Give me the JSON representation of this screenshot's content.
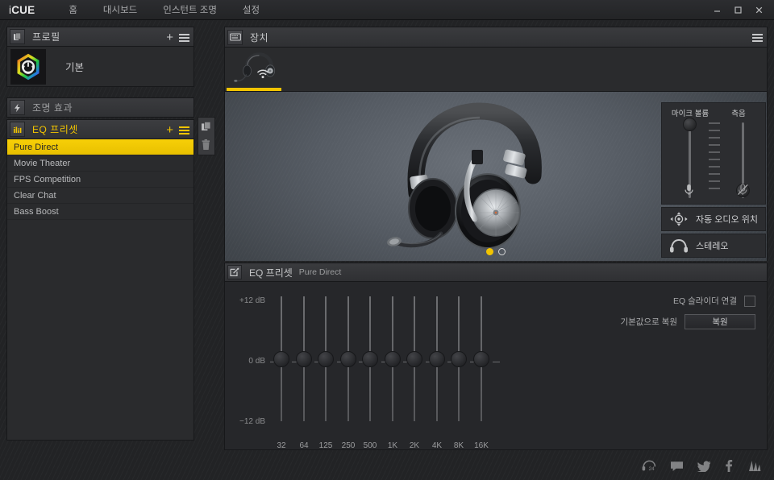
{
  "app": {
    "brand_i": "i",
    "brand_cue": "CUE",
    "nav": [
      {
        "label": "홈",
        "name": "nav-home"
      },
      {
        "label": "대시보드",
        "name": "nav-dashboard"
      },
      {
        "label": "인스턴트 조명",
        "name": "nav-instant-lighting"
      },
      {
        "label": "설정",
        "name": "nav-settings"
      }
    ],
    "window": {
      "minimize": "—",
      "maximize": "□",
      "close": "✕"
    }
  },
  "sidebar": {
    "profile": {
      "header_title": "프로필",
      "header_icon": "profile-stack-icon",
      "add_label": "+",
      "menu_icon": "hamburger-icon",
      "item_name": "기본"
    },
    "lighting": {
      "header_title": "조명 효과",
      "header_icon": "lightning-bolt-icon"
    },
    "eq": {
      "header_title": "EQ 프리셋",
      "header_icon": "equalizer-icon",
      "add_label": "+",
      "menu_icon": "hamburger-icon",
      "presets": [
        {
          "label": "Pure Direct",
          "selected": true
        },
        {
          "label": "Movie Theater",
          "selected": false
        },
        {
          "label": "FPS Competition",
          "selected": false
        },
        {
          "label": "Clear Chat",
          "selected": false
        },
        {
          "label": "Bass Boost",
          "selected": false
        }
      ]
    },
    "rail": {
      "copy_icon": "copy-icon",
      "delete_icon": "trash-icon"
    }
  },
  "device": {
    "header_title": "장치",
    "header_icon": "keyboard-icon",
    "menu_icon": "hamburger-icon",
    "tabs": [
      {
        "name": "device-tab-headset",
        "icon": "headset-icon",
        "wireless_icon": "wifi-icon",
        "active": true
      }
    ],
    "carousel_dots": [
      {
        "active": true
      },
      {
        "active": false
      }
    ]
  },
  "controls": {
    "mic_volume": {
      "label": "마이크 볼륨",
      "icon": "microphone-icon",
      "value": 97
    },
    "sidetone": {
      "label": "측음",
      "icon": "microphone-muted-icon",
      "value": 8
    },
    "audio_position": {
      "label": "자동 오디오 위치",
      "icon": "audio-position-icon"
    },
    "stereo": {
      "label": "스테레오",
      "icon": "headphones-icon"
    }
  },
  "eq_panel": {
    "header_icon": "edit-square-icon",
    "header_title": "EQ 프리셋",
    "header_subtitle": "Pure Direct",
    "link_sliders": {
      "label": "EQ 슬라이더 연결",
      "checked": false
    },
    "restore": {
      "label": "기본값으로 복원",
      "button_label": "복원"
    }
  },
  "chart_data": {
    "type": "bar",
    "title": "EQ 프리셋 Pure Direct",
    "xlabel": "",
    "ylabel": "dB",
    "ylim": [
      -12,
      12
    ],
    "axis_labels": {
      "max": "+12 dB",
      "mid": "0 dB",
      "min": "−12 dB"
    },
    "categories": [
      "32",
      "64",
      "125",
      "250",
      "500",
      "1K",
      "2K",
      "4K",
      "8K",
      "16K"
    ],
    "values": [
      0,
      0,
      0,
      0,
      0,
      0,
      0,
      0,
      0,
      0
    ],
    "grid": false,
    "legend": "none"
  },
  "footer": {
    "social": [
      {
        "name": "support-24-icon",
        "title": "support"
      },
      {
        "name": "forum-chat-icon",
        "title": "forum"
      },
      {
        "name": "twitter-icon",
        "title": "twitter"
      },
      {
        "name": "facebook-icon",
        "title": "facebook"
      },
      {
        "name": "corsair-sails-icon",
        "title": "corsair"
      }
    ]
  },
  "theme": {
    "accent": "#f2c400",
    "panel_bg": "#2a2b2d",
    "app_bg": "#222325",
    "text": "#c6c7c9"
  }
}
